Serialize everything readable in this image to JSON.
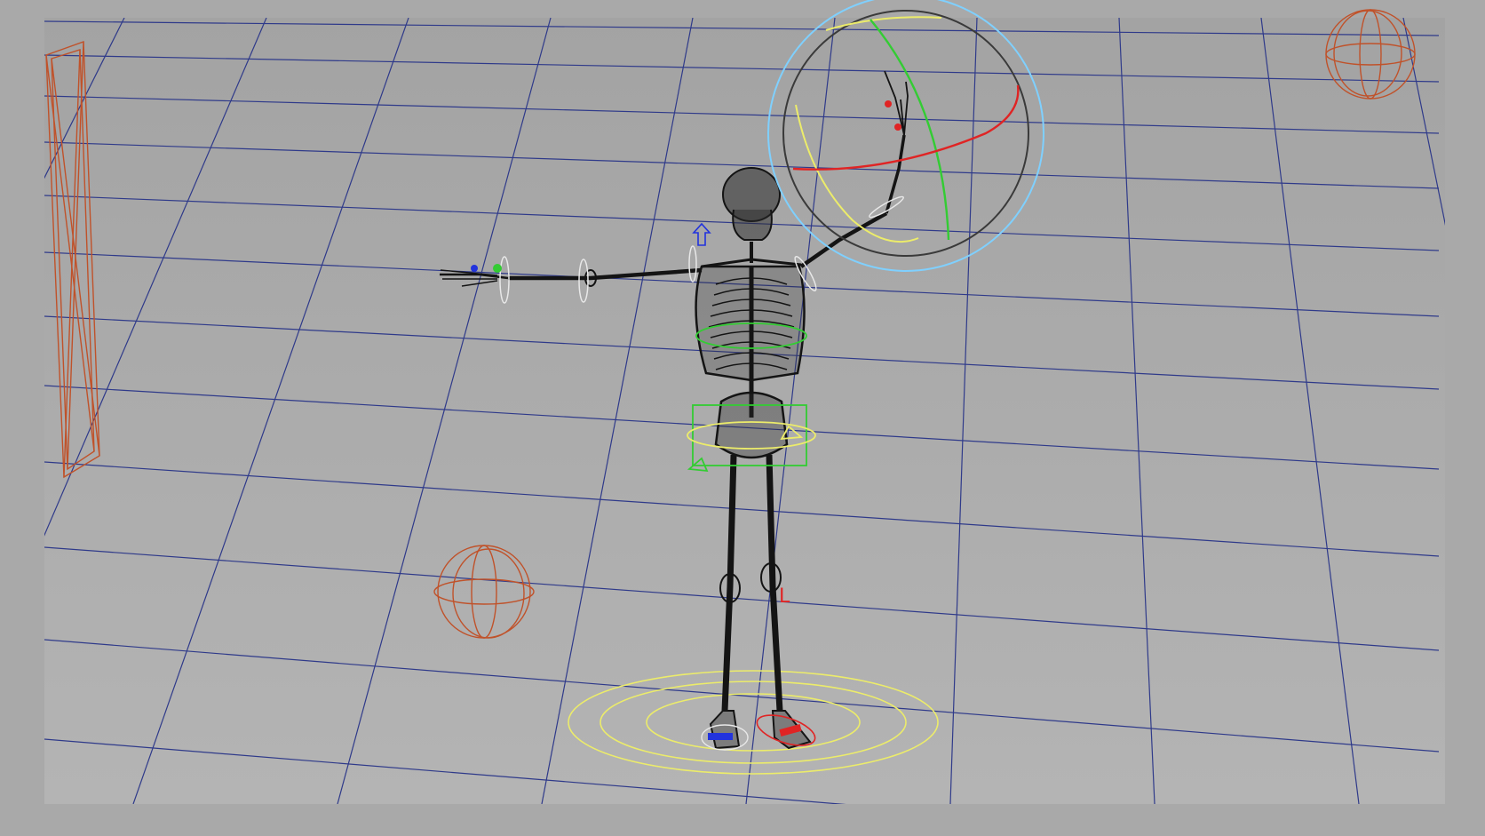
{
  "app": {
    "viewport_label": ""
  },
  "colors": {
    "outer_background": "#a9a9a9",
    "viewport_top": "#a3a3a3",
    "viewport_bottom": "#b4b4b4",
    "grid_line": "#2f3a8a",
    "wire": "#141414",
    "camera_frustum": "#c0522a",
    "light_gizmo": "#c0522a",
    "rotate_gizmo_outer": "#7fd0ff",
    "rotate_gizmo_inner": "#3a3a3a",
    "rotate_axis_x": "#e32020",
    "rotate_axis_y": "#25c325",
    "rotate_axis_z": "#e6e24a",
    "control_yellow": "#ecec6a",
    "control_green": "#33cc33",
    "control_red": "#e02424",
    "control_blue": "#2233dd"
  },
  "scene": {
    "objects": [
      {
        "name": "skeleton-mesh",
        "kind": "wireframe-mesh"
      },
      {
        "name": "rotate-manipulator",
        "kind": "rotate-tool-gizmo"
      },
      {
        "name": "camera-frustum",
        "kind": "camera"
      },
      {
        "name": "point-light-left",
        "kind": "light"
      },
      {
        "name": "point-light-right",
        "kind": "light"
      },
      {
        "name": "foot-ground-control",
        "kind": "rig-control"
      },
      {
        "name": "hip-control",
        "kind": "rig-control"
      }
    ]
  },
  "icons": {
    "up_arrow": "pole-vector-arrow-icon",
    "foot_label_l": "L"
  }
}
